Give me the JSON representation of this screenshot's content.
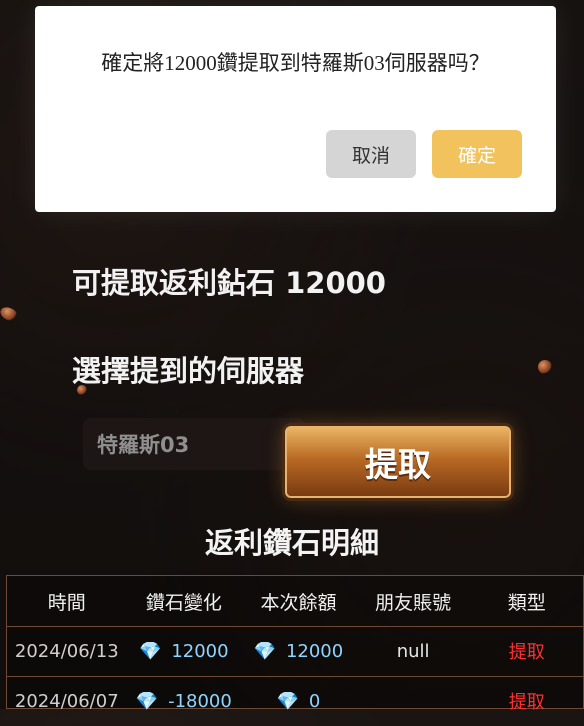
{
  "modal": {
    "message": "確定將12000鑽提取到特羅斯03伺服器吗？",
    "cancel_label": "取消",
    "confirm_label": "確定"
  },
  "rebate": {
    "balance_text": "可提取返利鉆石 12000",
    "select_server_label": "選擇提到的伺服器",
    "server_value": "特羅斯03",
    "withdraw_label": "提取"
  },
  "details": {
    "title": "返利鑽石明細",
    "headers": [
      "時間",
      "鑽石變化",
      "本次餘額",
      "朋友賬號",
      "類型"
    ],
    "rows": [
      {
        "time": "2024/06/13",
        "change": "12000",
        "balance": "12000",
        "friend": "null",
        "type": "提取"
      },
      {
        "time": "2024/06/07",
        "change": "-18000",
        "balance": "0",
        "friend": "",
        "type": "提取"
      }
    ]
  },
  "icons": {
    "diamond": "diamond-icon"
  },
  "colors": {
    "confirm_button": "#f2c35c",
    "cancel_button": "#d5d5d5",
    "diamond_value": "#8fd4ff",
    "type_text": "#ff2f2f"
  }
}
